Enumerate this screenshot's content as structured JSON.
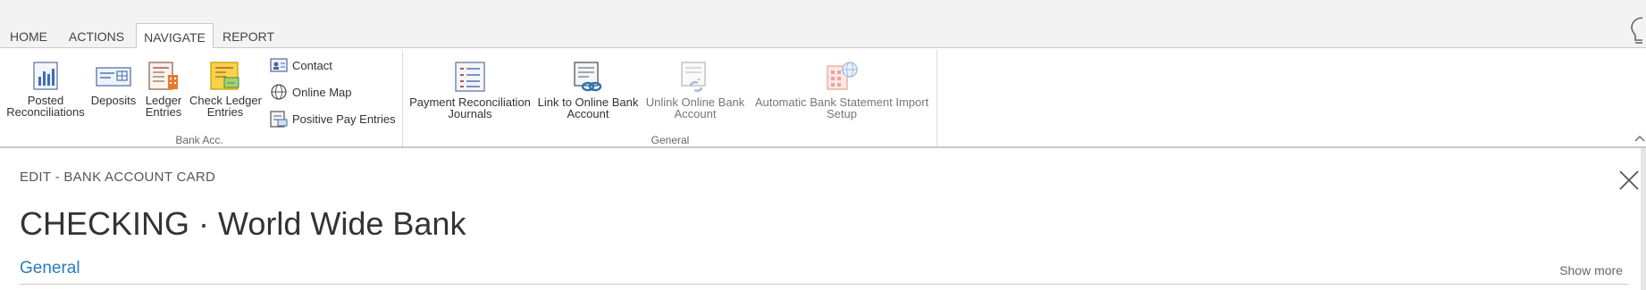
{
  "tabs": [
    {
      "label": "HOME"
    },
    {
      "label": "ACTIONS"
    },
    {
      "label": "NAVIGATE"
    },
    {
      "label": "REPORT"
    }
  ],
  "active_tab": "NAVIGATE",
  "ribbon": {
    "bank_acc": {
      "group_label": "Bank Acc.",
      "posted_reconciliations": {
        "line1": "Posted",
        "line2": "Reconciliations"
      },
      "deposits": {
        "line1": "Deposits"
      },
      "ledger_entries": {
        "line1": "Ledger",
        "line2": "Entries"
      },
      "check_ledger_entries": {
        "line1": "Check Ledger",
        "line2": "Entries"
      },
      "contact": "Contact",
      "online_map": "Online Map",
      "positive_pay_entries": "Positive Pay Entries"
    },
    "general": {
      "group_label": "General",
      "payment_reconciliation_journals": {
        "line1": "Payment Reconciliation",
        "line2": "Journals"
      },
      "link_to_online_bank_account": {
        "line1": "Link to Online Bank",
        "line2": "Account"
      },
      "unlink_online_bank_account": {
        "line1": "Unlink Online Bank",
        "line2": "Account"
      },
      "automatic_bank_statement_import_setup": {
        "line1": "Automatic Bank Statement Import",
        "line2": "Setup"
      }
    }
  },
  "highlight_color": "#ffff1f",
  "card": {
    "caption": "EDIT - BANK ACCOUNT CARD",
    "title": "CHECKING · World Wide Bank",
    "section": "General",
    "show_more": "Show more"
  },
  "icons": [
    "lightbulb-icon",
    "close-icon",
    "collapse-ribbon-icon"
  ]
}
